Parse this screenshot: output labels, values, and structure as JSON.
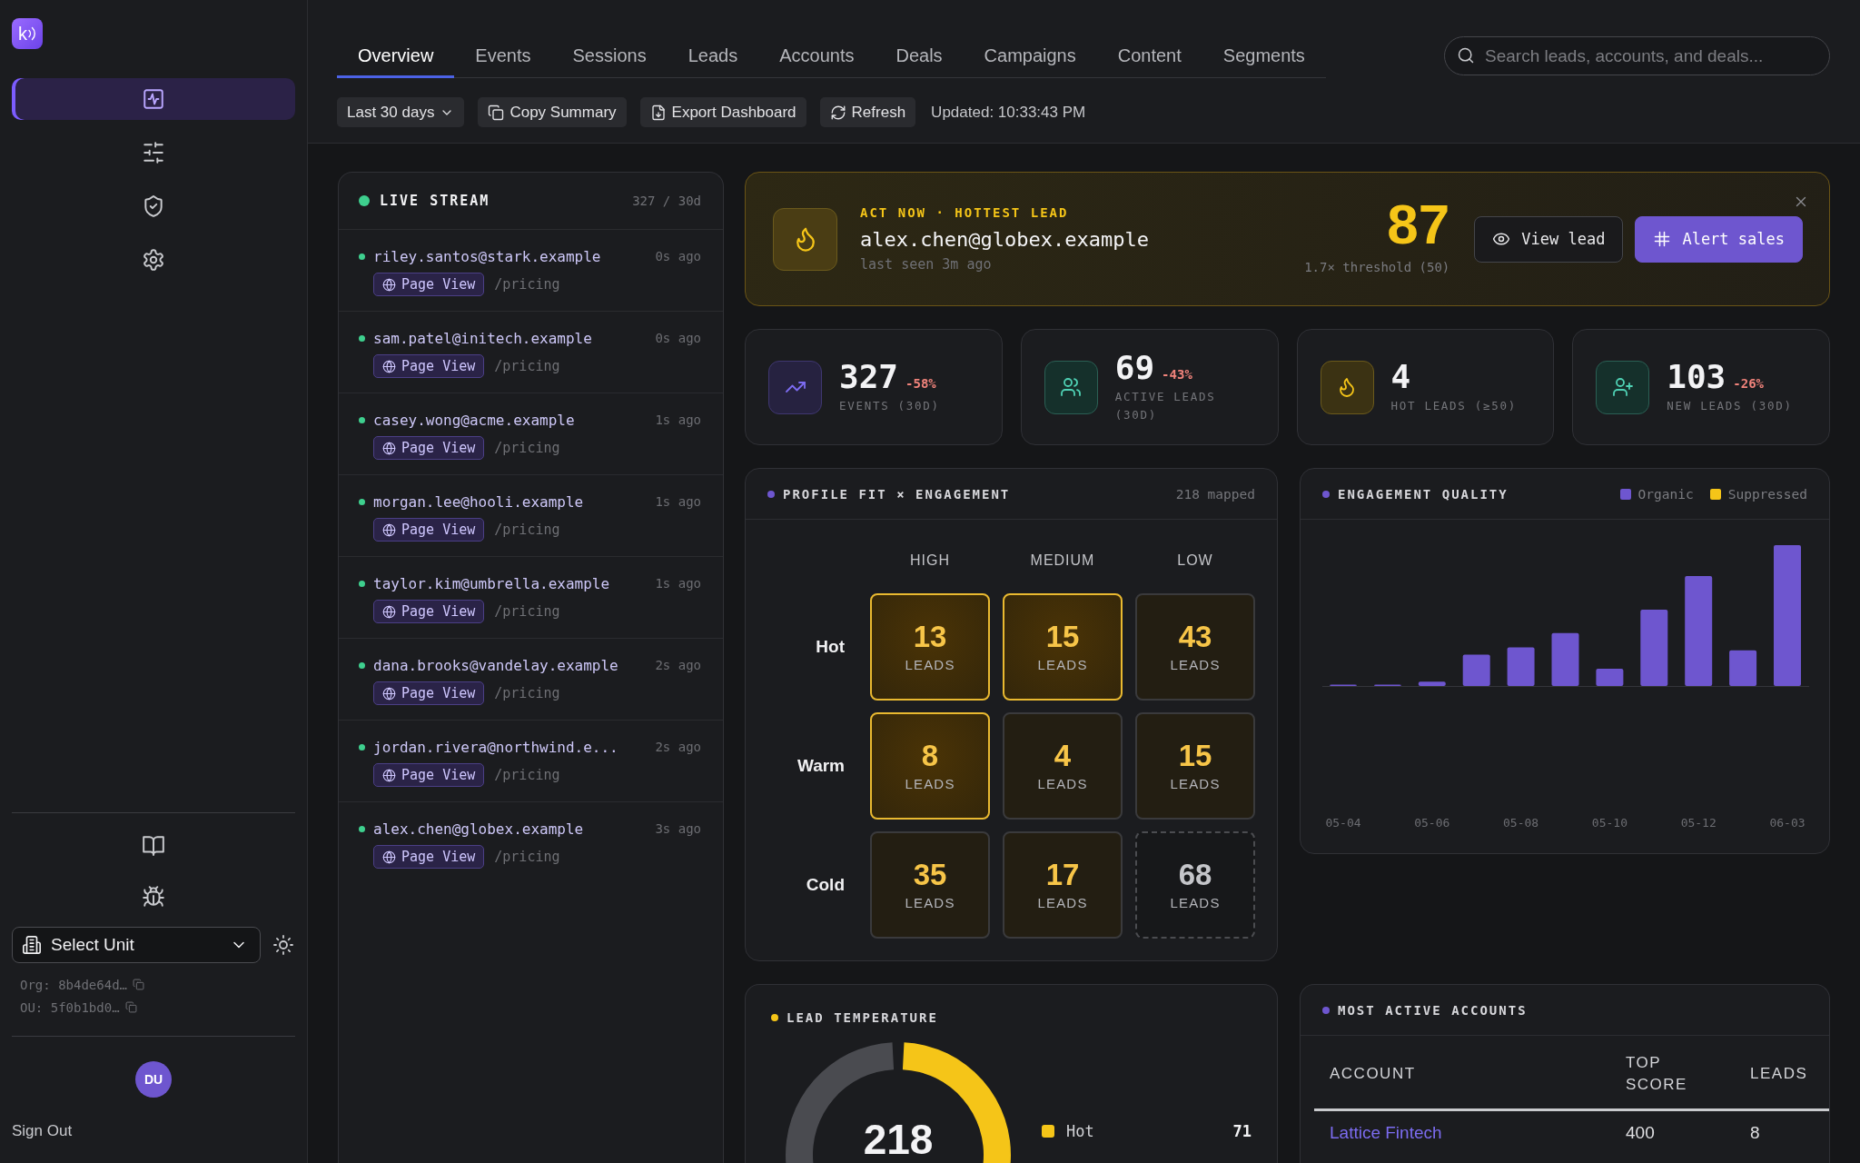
{
  "sidebar": {
    "logo": "k",
    "nav": [
      {
        "selected": true
      },
      {
        "selected": false
      },
      {
        "selected": false
      },
      {
        "selected": false
      }
    ],
    "unit_select": "Select Unit",
    "ids": [
      "Org: 8b4de64d…",
      "OU: 5f0b1bd0…"
    ],
    "avatar": "DU",
    "sign_out": "Sign Out"
  },
  "tabs": [
    {
      "label": "Overview",
      "selected": true
    },
    {
      "label": "Events",
      "selected": false
    },
    {
      "label": "Sessions",
      "selected": false
    },
    {
      "label": "Leads",
      "selected": false
    },
    {
      "label": "Accounts",
      "selected": false
    },
    {
      "label": "Deals",
      "selected": false
    },
    {
      "label": "Campaigns",
      "selected": false
    },
    {
      "label": "Content",
      "selected": false
    },
    {
      "label": "Segments",
      "selected": false
    }
  ],
  "search": {
    "placeholder": "Search leads, accounts, and deals..."
  },
  "toolbar": {
    "range": "Last 30 days",
    "buttons": [
      "Copy Summary",
      "Export Dashboard",
      "Refresh"
    ],
    "updated": "Updated: 10:33:43 PM"
  },
  "live_stream": {
    "title": "LIVE STREAM",
    "count": "327 / 30d",
    "events": [
      {
        "email": "riley.santos@stark.example",
        "time": "0s ago",
        "type": "Page View",
        "path": "/pricing"
      },
      {
        "email": "sam.patel@initech.example",
        "time": "0s ago",
        "type": "Page View",
        "path": "/pricing"
      },
      {
        "email": "casey.wong@acme.example",
        "time": "1s ago",
        "type": "Page View",
        "path": "/pricing"
      },
      {
        "email": "morgan.lee@hooli.example",
        "time": "1s ago",
        "type": "Page View",
        "path": "/pricing"
      },
      {
        "email": "taylor.kim@umbrella.example",
        "time": "1s ago",
        "type": "Page View",
        "path": "/pricing"
      },
      {
        "email": "dana.brooks@vandelay.example",
        "time": "2s ago",
        "type": "Page View",
        "path": "/pricing"
      },
      {
        "email": "jordan.rivera@northwind.e...",
        "time": "2s ago",
        "type": "Page View",
        "path": "/pricing"
      },
      {
        "email": "alex.chen@globex.example",
        "time": "3s ago",
        "type": "Page View",
        "path": "/pricing"
      }
    ]
  },
  "hot_lead": {
    "eyebrow": "ACT NOW · HOTTEST LEAD",
    "email": "alex.chen@globex.example",
    "last_seen": "last seen 3m ago",
    "score": "87",
    "threshold": "1.7× threshold (50)",
    "actions": [
      {
        "label": "View lead",
        "kind": "secondary"
      },
      {
        "label": "Alert sales",
        "kind": "primary"
      }
    ]
  },
  "stats": [
    {
      "value": "327",
      "delta": "-58%",
      "label": "EVENTS (30D)"
    },
    {
      "value": "69",
      "delta": "-43%",
      "label": "ACTIVE LEADS (30D)"
    },
    {
      "value": "4",
      "label": "HOT LEADS (≥50)"
    },
    {
      "value": "103",
      "delta": "-26%",
      "label": "NEW LEADS (30D)"
    }
  ],
  "profile_fit": {
    "title": "PROFILE FIT × ENGAGEMENT",
    "count": "218 mapped",
    "columns": [
      "HIGH",
      "MEDIUM",
      "LOW"
    ],
    "rows": [
      {
        "label": "Hot",
        "cells": [
          {
            "value": "13",
            "unit": "LEADS",
            "kind": "highlight"
          },
          {
            "value": "15",
            "unit": "LEADS",
            "kind": "highlight"
          },
          {
            "value": "43",
            "unit": "LEADS",
            "kind": "plain"
          }
        ]
      },
      {
        "label": "Warm",
        "cells": [
          {
            "value": "8",
            "unit": "LEADS",
            "kind": "highlight"
          },
          {
            "value": "4",
            "unit": "LEADS",
            "kind": "plain"
          },
          {
            "value": "15",
            "unit": "LEADS",
            "kind": "plain"
          }
        ]
      },
      {
        "label": "Cold",
        "cells": [
          {
            "value": "35",
            "unit": "LEADS",
            "kind": "plain"
          },
          {
            "value": "17",
            "unit": "LEADS",
            "kind": "plain"
          },
          {
            "value": "68",
            "unit": "LEADS",
            "kind": "dashed"
          }
        ]
      }
    ]
  },
  "engagement_quality": {
    "title": "ENGAGEMENT QUALITY",
    "legend": [
      {
        "label": "Organic",
        "color": "#6e56cf"
      },
      {
        "label": "Suppressed",
        "color": "#f5c518"
      }
    ],
    "x_labels": [
      "05-04",
      "05-06",
      "05-08",
      "05-10",
      "05-12",
      "06-03"
    ]
  },
  "lead_temperature": {
    "title": "LEAD TEMPERATURE",
    "total": "218",
    "legend": [
      {
        "label": "Hot",
        "value": "71",
        "color": "#f5c518"
      }
    ]
  },
  "active_accounts": {
    "title": "MOST ACTIVE ACCOUNTS",
    "columns": [
      "ACCOUNT",
      "TOP SCORE",
      "LEADS"
    ],
    "rows": [
      {
        "account": "Lattice Fintech",
        "top_score": "400",
        "leads": "8"
      }
    ]
  }
}
